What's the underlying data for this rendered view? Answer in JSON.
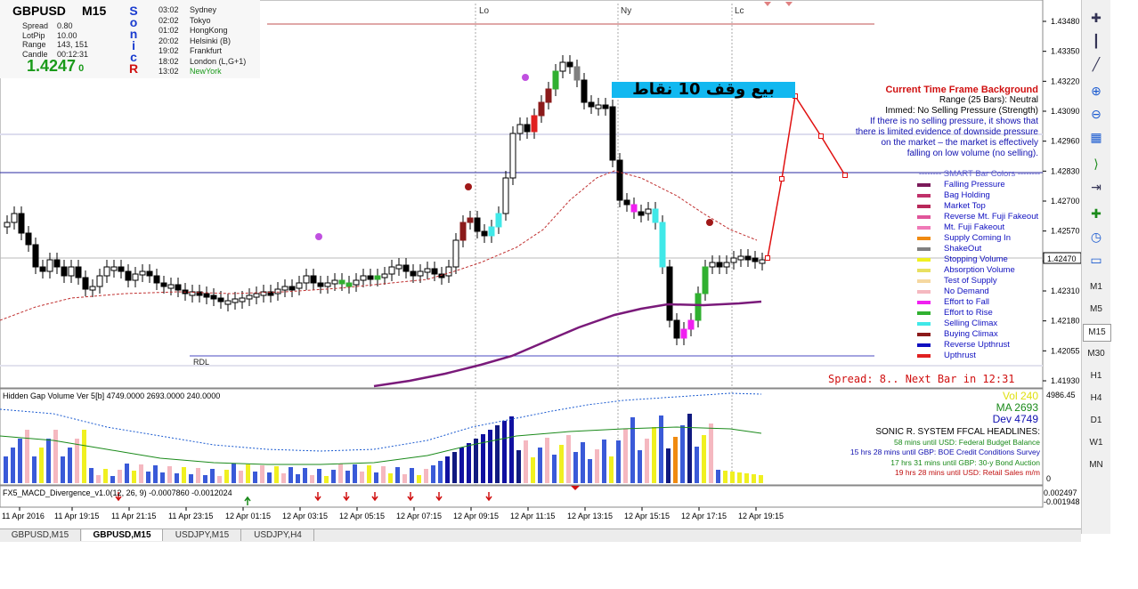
{
  "info_panel": {
    "symbol": "GBPUSD",
    "timeframe": "M15",
    "sonic": [
      "S",
      "o",
      "n",
      "i",
      "c",
      "R"
    ],
    "rows": [
      {
        "label": "Spread",
        "value": "0.80"
      },
      {
        "label": "LotPip",
        "value": "10.00"
      },
      {
        "label": "Range",
        "value": "143, 151"
      },
      {
        "label": "Candle",
        "value": "00:12:31"
      }
    ],
    "price": "1.4247",
    "price_suffix": "0",
    "sessions": [
      {
        "time": "03:02",
        "name": "Sydney"
      },
      {
        "time": "02:02",
        "name": "Tokyo"
      },
      {
        "time": "01:02",
        "name": "HongKong"
      },
      {
        "time": "20:02",
        "name": "Helsinki  (B)"
      },
      {
        "time": "19:02",
        "name": "Frankfurt"
      },
      {
        "time": "18:02",
        "name": "London  (L,G+1)"
      },
      {
        "time": "13:02",
        "name": "NewYork"
      }
    ]
  },
  "session_markers": [
    "Lo",
    "Ny",
    "Lc"
  ],
  "rdl_label": "RDL",
  "arabic_banner": "بيع وقف 10 نقاط",
  "background_info": {
    "title": "Current Time Frame Background",
    "lines": [
      "Range (25 Bars): Neutral",
      "Immed: No Selling Pressure (Strength)",
      "If there is no selling pressure, it shows that",
      "there is limited evidence of downside pressure",
      "on the market – the market is effectively",
      "falling on low volume (no selling)."
    ]
  },
  "smart_legend": {
    "title": "SMART Bar Colors",
    "items": [
      {
        "label": "Falling Pressure",
        "color": "#7b1a5a"
      },
      {
        "label": "Bag Holding",
        "color": "#c0306a"
      },
      {
        "label": "Market Top",
        "color": "#b8285a"
      },
      {
        "label": "Reverse Mt. Fuji Fakeout",
        "color": "#e0559a"
      },
      {
        "label": "Mt. Fuji Fakeout",
        "color": "#f07ab8"
      },
      {
        "label": "Supply Coming In",
        "color": "#f08a10"
      },
      {
        "label": "ShakeOut",
        "color": "#808080"
      },
      {
        "label": "Stopping Volume",
        "color": "#f0f020"
      },
      {
        "label": "Absorption Volume",
        "color": "#e8e060"
      },
      {
        "label": "Test of Supply",
        "color": "#f5d8a0"
      },
      {
        "label": "No Demand",
        "color": "#f5b8c0"
      },
      {
        "label": "Effort to Fall",
        "color": "#f020f0"
      },
      {
        "label": "Effort to Rise",
        "color": "#30b030"
      },
      {
        "label": "Selling Climax",
        "color": "#40e8e8"
      },
      {
        "label": "Buying Climax",
        "color": "#8b1a1a"
      },
      {
        "label": "Reverse Upthrust",
        "color": "#1010c0"
      },
      {
        "label": "Upthrust",
        "color": "#e02020"
      }
    ]
  },
  "price_axis": [
    "1.43480",
    "1.43350",
    "1.43220",
    "1.43090",
    "1.42960",
    "1.42830",
    "1.42700",
    "1.42570",
    "1.42440",
    "1.42310",
    "1.42180",
    "1.42055",
    "1.41930"
  ],
  "current_price_label": "1.42470",
  "spread_line": "Spread: 8.. Next Bar in 12:31",
  "volume_panel": {
    "title": "Hidden Gap Volume Ver 5[b] 4749.0000 2693.0000 240.0000",
    "vol": "Vol  240",
    "ma": "MA  2693",
    "dev": "Dev  4749",
    "axis_top": "4986.45",
    "axis_bottom": "0"
  },
  "headlines": {
    "title": "SONIC R. SYSTEM  FFCAL HEADLINES:",
    "items": [
      {
        "text": "58 mins until USD: Federal Budget Balance",
        "color": "#1a8a1a"
      },
      {
        "text": "15 hrs 28 mins until GBP: BOE Credit Conditions Survey",
        "color": "#1010b0"
      },
      {
        "text": "17 hrs 31 mins until GBP: 30-y Bond Auction",
        "color": "#1a8a1a"
      },
      {
        "text": "19 hrs 28 mins until USD: Retail Sales m/m",
        "color": "#c01010"
      }
    ]
  },
  "macd_panel": {
    "title": "FX5_MACD_Divergence_v1.0(12, 26, 9) -0.0007860 -0.0012024",
    "axis_top": "0.002497",
    "axis_bottom": "-0.001948"
  },
  "time_axis": [
    "11 Apr 2016",
    "11 Apr 19:15",
    "11 Apr 21:15",
    "11 Apr 23:15",
    "12 Apr 01:15",
    "12 Apr 03:15",
    "12 Apr 05:15",
    "12 Apr 07:15",
    "12 Apr 09:15",
    "12 Apr 11:15",
    "12 Apr 13:15",
    "12 Apr 15:15",
    "12 Apr 17:15",
    "12 Apr 19:15"
  ],
  "timeframes": [
    "M1",
    "M5",
    "M15",
    "M30",
    "H1",
    "H4",
    "D1",
    "W1",
    "MN"
  ],
  "active_timeframe": "M15",
  "toolbar_icons": [
    "crosshair-icon",
    "vertical-line-icon",
    "trend-line-icon",
    "zoom-in-icon",
    "zoom-out-icon",
    "tile-windows-icon",
    "period-separator-icon",
    "autoscroll-icon",
    "new-indicator-icon",
    "clock-icon",
    "chart-shift-icon"
  ],
  "chart_tabs": [
    "GBPUSD,M15",
    "GBPUSD,M15",
    "USDJPY,M15",
    "USDJPY,H4"
  ],
  "active_tab": 1,
  "colors": {
    "sonic": "#1a3ccf",
    "sonic_r": "#d01010",
    "price_green": "#1a9a1a",
    "banner": "#12b8f0",
    "forecast": "#e01010",
    "ema": "#7a1a7a",
    "red_dashed": "#c03030"
  }
}
